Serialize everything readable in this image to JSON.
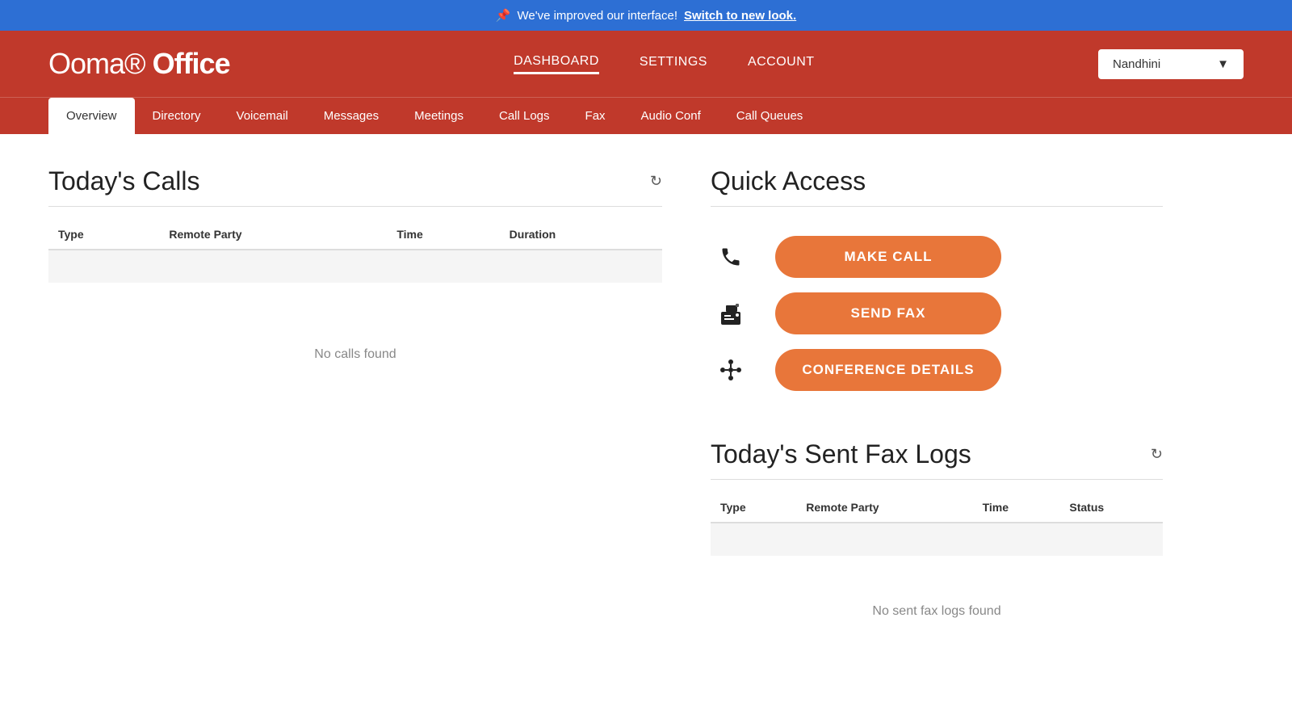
{
  "announcement": {
    "message": "We've improved our interface!",
    "link_text": "Switch to new look.",
    "icon": "🔔"
  },
  "header": {
    "logo": "Ooma",
    "logo_suffix": "Office",
    "nav": [
      {
        "label": "DASHBOARD",
        "active": true
      },
      {
        "label": "SETTINGS",
        "active": false
      },
      {
        "label": "ACCOUNT",
        "active": false
      }
    ],
    "user": "Nandhini"
  },
  "sub_nav": [
    {
      "label": "Overview",
      "active": true
    },
    {
      "label": "Directory",
      "active": false
    },
    {
      "label": "Voicemail",
      "active": false
    },
    {
      "label": "Messages",
      "active": false
    },
    {
      "label": "Meetings",
      "active": false
    },
    {
      "label": "Call Logs",
      "active": false
    },
    {
      "label": "Fax",
      "active": false
    },
    {
      "label": "Audio Conf",
      "active": false
    },
    {
      "label": "Call Queues",
      "active": false
    }
  ],
  "calls_section": {
    "title": "Today's Calls",
    "columns": [
      "Type",
      "Remote Party",
      "Time",
      "Duration"
    ],
    "no_data": "No calls found"
  },
  "quick_access": {
    "title": "Quick Access",
    "items": [
      {
        "label": "MAKE CALL",
        "icon": "phone"
      },
      {
        "label": "SEND FAX",
        "icon": "fax"
      },
      {
        "label": "CONFERENCE DETAILS",
        "icon": "conference"
      }
    ]
  },
  "fax_logs": {
    "title": "Today's Sent Fax Logs",
    "columns": [
      "Type",
      "Remote Party",
      "Time",
      "Status"
    ],
    "no_data": "No sent fax logs found"
  },
  "colors": {
    "accent": "#e8763a",
    "header_bg": "#c0392b",
    "announcement_bg": "#2d6fd4"
  }
}
